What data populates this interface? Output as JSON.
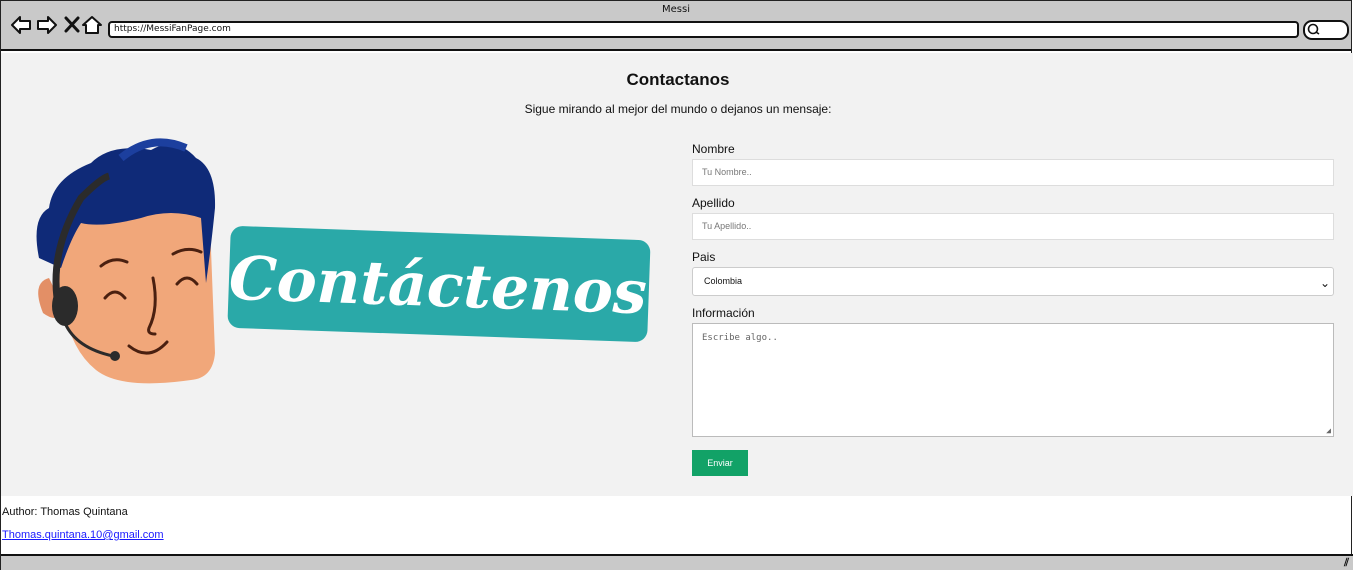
{
  "window": {
    "title": "Messi",
    "url": "https://MessiFanPage.com"
  },
  "page": {
    "heading": "Contactanos",
    "subheading": "Sigue mirando al mejor del mundo o dejanos un mensaje:",
    "illustration_text": "Contáctenos"
  },
  "form": {
    "nombre_label": "Nombre",
    "nombre_placeholder": "Tu Nombre..",
    "apellido_label": "Apellido",
    "apellido_placeholder": "Tu Apellido..",
    "pais_label": "Pais",
    "pais_value": "Colombia",
    "info_label": "Información",
    "info_placeholder": "Escribe algo..",
    "submit_label": "Enviar"
  },
  "footer": {
    "author": "Author: Thomas Quintana",
    "email": "Thomas.quintana.10@gmail.com"
  },
  "colors": {
    "submit_button": "#12a267",
    "illustration_banner": "#2aa9a8",
    "hair": "#0f2a78",
    "skin": "#f1a77a"
  }
}
